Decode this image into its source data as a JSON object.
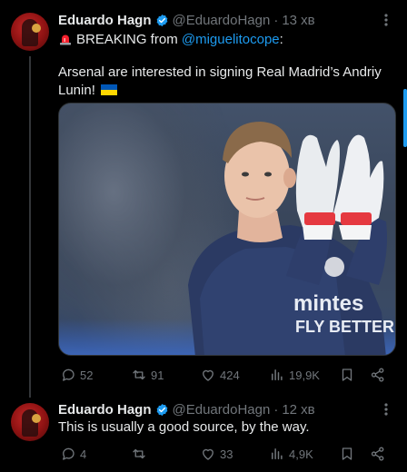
{
  "tweets": [
    {
      "author": {
        "name": "Eduardo Hagn",
        "handle": "@EduardoHagn",
        "separator": "·",
        "time": "13 хв"
      },
      "breaking_prefix": "BREAKING from",
      "mention": "@miguelitocope",
      "breaking_suffix": ":",
      "body": "Arsenal are interested in signing Real Madrid’s Andriy Lunin!",
      "stats": {
        "replies": "52",
        "reposts": "91",
        "likes": "424",
        "views": "19,9K"
      }
    },
    {
      "author": {
        "name": "Eduardo Hagn",
        "handle": "@EduardoHagn",
        "separator": "·",
        "time": "12 хв"
      },
      "body": "This is usually a good source, by the way.",
      "stats": {
        "replies": "4",
        "reposts": "",
        "likes": "33",
        "views": "4,9K"
      }
    }
  ],
  "colors": {
    "background": "#000000",
    "text": "#e7e9ea",
    "muted": "#71767b",
    "accent": "#1d9bf0"
  },
  "icons": [
    "siren-icon",
    "ukraine-flag-icon",
    "verified-badge-icon",
    "more-icon",
    "reply-icon",
    "repost-icon",
    "like-icon",
    "views-icon",
    "bookmark-icon",
    "share-icon"
  ]
}
